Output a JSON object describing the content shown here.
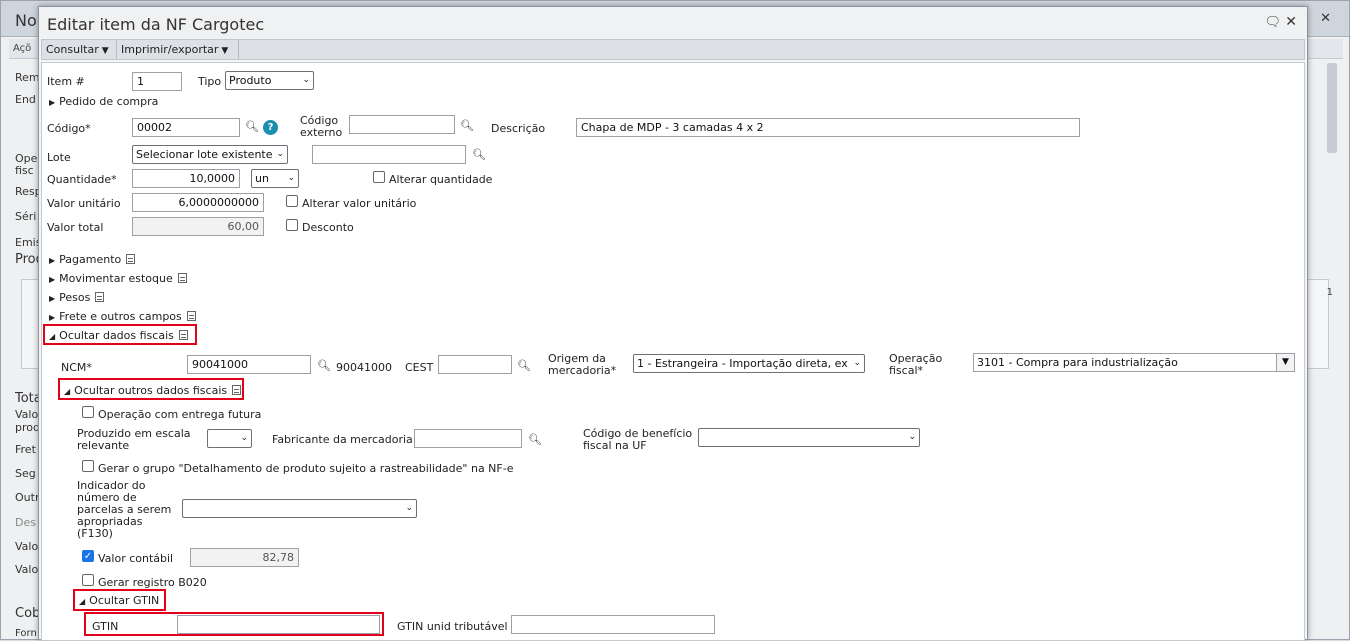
{
  "background": {
    "title": "No",
    "toolbar_label": "Açõ",
    "labels": [
      "Rem",
      "End",
      "Ope",
      "fisc",
      "Resp",
      "Séri",
      "Emis",
      "Prod",
      "Tota",
      "Valo",
      "prod",
      "Fret",
      "Seg",
      "Outr",
      "Des",
      "Valo",
      "Valo",
      "Cob",
      "Forn"
    ],
    "grid_number": "1",
    "close_glyph": "✕"
  },
  "modal": {
    "title": "Editar item da NF Cargotec",
    "toolbar": {
      "consultar": "Consultar",
      "imprimir": "Imprimir/exportar"
    }
  },
  "form": {
    "item_label": "Item #",
    "item_value": "1",
    "tipo_label": "Tipo",
    "tipo_value": "Produto",
    "pedido_label": "Pedido de compra",
    "codigo_label": "Código*",
    "codigo_value": "00002",
    "codigo_externo_label": "Código externo",
    "codigo_externo_value": "",
    "descricao_label": "Descrição",
    "descricao_value": "Chapa de MDP - 3 camadas 4 x 2",
    "lote_label": "Lote",
    "lote_value": "Selecionar lote existente",
    "lote_text": "",
    "quantidade_label": "Quantidade*",
    "quantidade_value": "10,0000",
    "unidade_value": "un",
    "alterar_quantidade_label": "Alterar quantidade",
    "valor_unitario_label": "Valor unitário",
    "valor_unitario_value": "6,0000000000",
    "alterar_valor_label": "Alterar valor unitário",
    "valor_total_label": "Valor total",
    "valor_total_value": "60,00",
    "desconto_label": "Desconto",
    "sections": {
      "pagamento": "Pagamento",
      "movimentar": "Movimentar estoque",
      "pesos": "Pesos",
      "frete": "Frete e outros campos",
      "ocultar_fiscais": "Ocultar dados fiscais"
    },
    "ncm_label": "NCM*",
    "ncm_value": "90041000",
    "ncm_text": "90041000",
    "cest_label": "CEST",
    "cest_value": "",
    "origem_label": "Origem da mercadoria*",
    "origem_value": "1 - Estrangeira - Importação direta, ex",
    "operacao_label": "Operação fiscal*",
    "operacao_value": "3101 - Compra para industrialização",
    "ocultar_outros": "Ocultar outros dados fiscais",
    "entrega_futura_label": "Operação com entrega futura",
    "escala_label": "Produzido em escala relevante",
    "escala_value": "",
    "fabricante_label": "Fabricante da mercadoria",
    "fabricante_value": "",
    "beneficio_label": "Código de benefício fiscal na UF",
    "beneficio_value": "",
    "rastreabilidade_label": "Gerar o grupo \"Detalhamento de produto sujeito a rastreabilidade\" na NF-e",
    "indicador_label": "Indicador do número de parcelas a serem apropriadas (F130)",
    "indicador_value": "",
    "valor_contabil_label": "Valor contábil",
    "valor_contabil_value": "82,78",
    "b020_label": "Gerar registro B020",
    "ocultar_gtin": "Ocultar GTIN",
    "gtin_label": "GTIN",
    "gtin_value": "",
    "gtin_trib_label": "GTIN unid tributável",
    "gtin_trib_value": ""
  },
  "colors": {
    "highlight": "#e3001b",
    "checkbox_on": "#1a73e8"
  },
  "icons": [
    "search-icon",
    "help-icon",
    "chat-icon",
    "close-icon",
    "document-icon",
    "chevron-down-icon",
    "triangle-right-icon",
    "triangle-down-icon"
  ]
}
